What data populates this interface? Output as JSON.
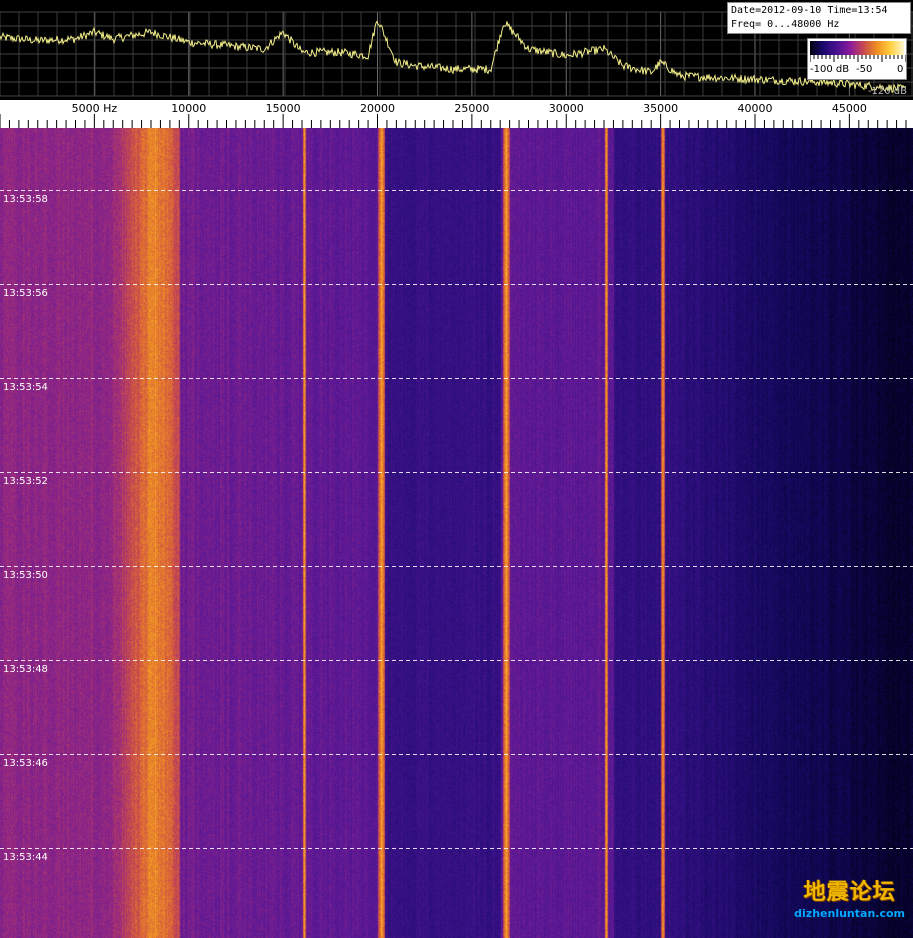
{
  "info": {
    "line1": "Date=2012-09-10 Time=13:54",
    "line2": "Freq= 0...48000 Hz"
  },
  "colorbar": {
    "labels": [
      "-100 dB",
      "-50",
      "0"
    ],
    "bottom_label": "-120 dB"
  },
  "watermark": {
    "main": "地震论坛",
    "sub": "dizhenluntan.com"
  },
  "colors": {
    "trace": "#f4f08a",
    "grid": "#6a6a6a",
    "dashed": "#ffffff",
    "time_label": "#ffffff"
  },
  "chart_data": {
    "type": "heatmap",
    "title": "",
    "xlabel": "",
    "ylabel": "",
    "unit": "Hz",
    "freq_range": [
      0,
      48000
    ],
    "x_ticks": [
      {
        "value": 5000,
        "label": "5000 Hz"
      },
      {
        "value": 10000,
        "label": "10000"
      },
      {
        "value": 15000,
        "label": "15000"
      },
      {
        "value": 20000,
        "label": "20000"
      },
      {
        "value": 25000,
        "label": "25000"
      },
      {
        "value": 30000,
        "label": "30000"
      },
      {
        "value": 35000,
        "label": "35000"
      },
      {
        "value": 40000,
        "label": "40000"
      },
      {
        "value": 45000,
        "label": "45000"
      }
    ],
    "time_labels": [
      "13:53:58",
      "13:53:56",
      "13:53:54",
      "13:53:52",
      "13:53:50",
      "13:53:48",
      "13:53:46",
      "13:53:44"
    ],
    "db_range": [
      -120,
      0
    ],
    "spectrum_trace": {
      "freqs": [
        0,
        2000,
        4000,
        5000,
        6000,
        8000,
        10000,
        12000,
        14000,
        15000,
        16000,
        18000,
        19500,
        20000,
        21000,
        22000,
        24000,
        25000,
        26000,
        26700,
        28000,
        30000,
        32000,
        33000,
        34500,
        35000,
        36000,
        40000,
        44000,
        46000,
        48000
      ],
      "db": [
        -55,
        -57,
        -56,
        -52,
        -56,
        -52,
        -58,
        -60,
        -62,
        -52,
        -64,
        -64,
        -66,
        -44,
        -70,
        -72,
        -74,
        -74,
        -74,
        -46,
        -62,
        -66,
        -62,
        -72,
        -76,
        -70,
        -78,
        -80,
        -82,
        -84,
        -86
      ]
    },
    "strong_lines_hz": [
      8200,
      16100,
      20200,
      26800,
      32100,
      35100
    ]
  }
}
